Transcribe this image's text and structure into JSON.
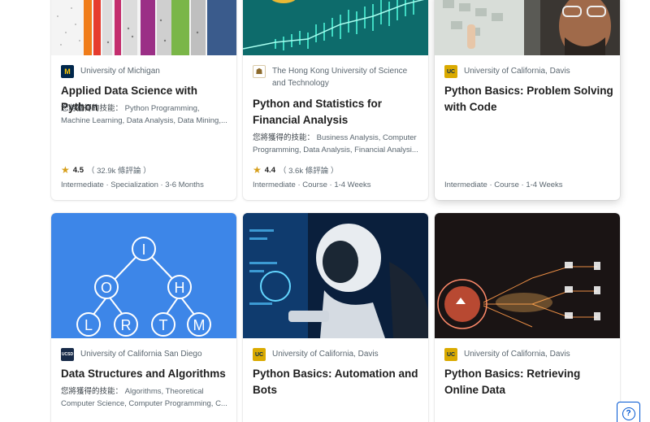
{
  "skills_label": "您將獲得的技能：",
  "cards": [
    {
      "partner": "University of Michigan",
      "logo_text": "M",
      "title": "Applied Data Science with Python",
      "skills": "Python Programming, Machine Learning, Data Analysis, Data Mining,...",
      "rating": "4.5",
      "reviews": "（ 32.9k 條評論 ）",
      "meta": "Intermediate · Specialization · 3-6 Months"
    },
    {
      "partner": "The Hong Kong University of Science and Technology",
      "logo_text": "☗",
      "title": "Python and Statistics for Financial Analysis",
      "skills": "Business Analysis, Computer Programming, Data Analysis, Financial Analysi...",
      "rating": "4.4",
      "reviews": "（ 3.6k 條評論 ）",
      "meta": "Intermediate · Course · 1-4 Weeks"
    },
    {
      "partner": "University of California, Davis",
      "logo_text": "UC",
      "title": "Python Basics: Problem Solving with Code",
      "meta": "Intermediate · Course · 1-4 Weeks"
    },
    {
      "partner": "University of California San Diego",
      "logo_text": "UCSD",
      "title": "Data Structures and Algorithms",
      "skills": "Algorithms, Theoretical Computer Science, Computer Programming, C...",
      "thumb_letters": [
        "I",
        "O",
        "H",
        "L",
        "R",
        "T",
        "M"
      ]
    },
    {
      "partner": "University of California, Davis",
      "logo_text": "UC",
      "title": "Python Basics: Automation and Bots"
    },
    {
      "partner": "University of California, Davis",
      "logo_text": "UC",
      "title": "Python Basics: Retrieving Online Data"
    }
  ],
  "help_icon_text": "?"
}
